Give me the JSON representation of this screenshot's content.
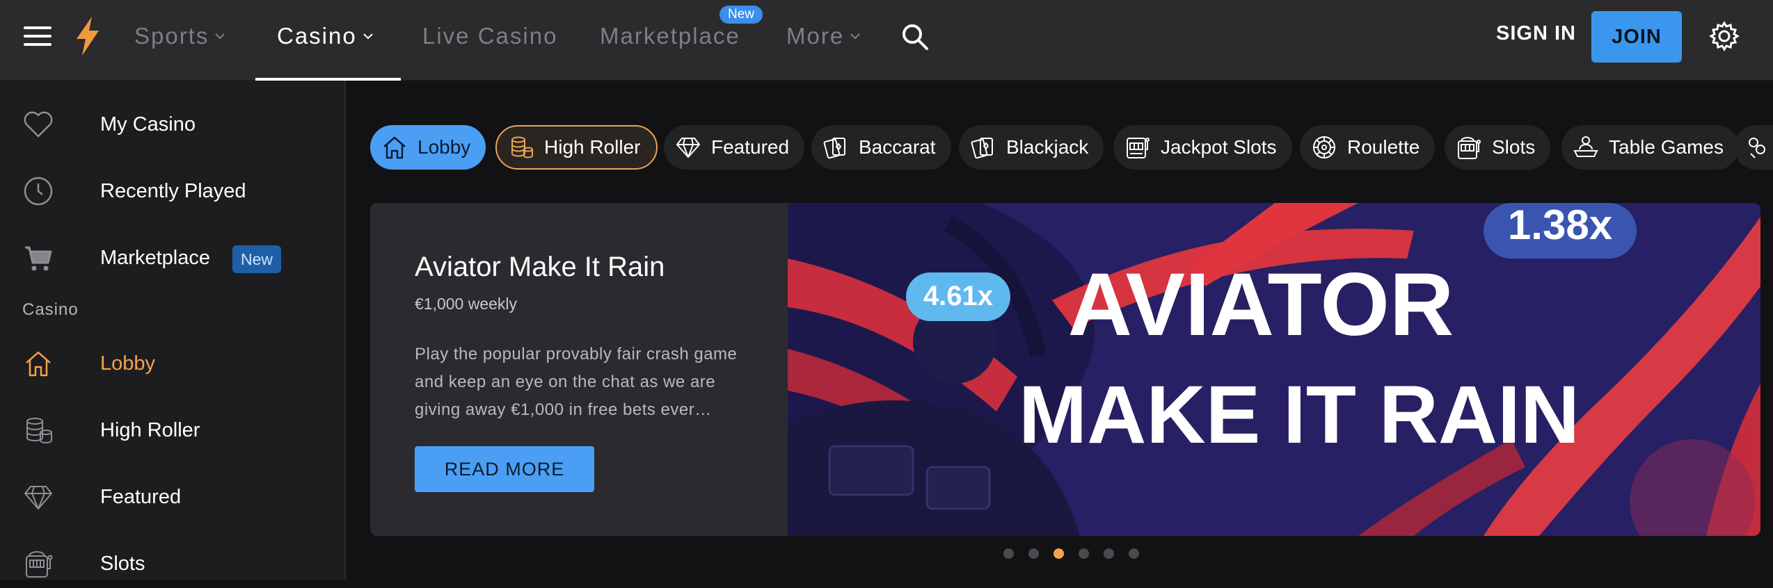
{
  "topbar": {
    "nav": [
      {
        "label": "Sports",
        "has_chevron": true
      },
      {
        "label": "Casino",
        "has_chevron": true,
        "active": true
      },
      {
        "label": "Live Casino"
      },
      {
        "label": "Marketplace",
        "badge": "New"
      },
      {
        "label": "More",
        "has_chevron": true
      }
    ],
    "sign_in": "SIGN IN",
    "join": "JOIN"
  },
  "sidebar": {
    "items": [
      {
        "label": "My Casino",
        "icon": "heart-icon"
      },
      {
        "label": "Recently Played",
        "icon": "clock-icon"
      },
      {
        "label": "Marketplace",
        "icon": "cart-icon",
        "badge": "New"
      }
    ],
    "section": "Casino",
    "casino_items": [
      {
        "label": "Lobby",
        "icon": "home-icon",
        "active": true
      },
      {
        "label": "High Roller",
        "icon": "coins-icon"
      },
      {
        "label": "Featured",
        "icon": "diamond-icon"
      },
      {
        "label": "Slots",
        "icon": "slot-machine-icon"
      }
    ]
  },
  "categories": [
    {
      "label": "Lobby",
      "icon": "home-icon",
      "selected": true
    },
    {
      "label": "High Roller",
      "icon": "coins-icon"
    },
    {
      "label": "Featured",
      "icon": "diamond-icon"
    },
    {
      "label": "Baccarat",
      "icon": "cards-icon"
    },
    {
      "label": "Blackjack",
      "icon": "cards-icon"
    },
    {
      "label": "Jackpot Slots",
      "icon": "jackpot-icon"
    },
    {
      "label": "Roulette",
      "icon": "roulette-icon"
    },
    {
      "label": "Slots",
      "icon": "slot-machine-icon"
    },
    {
      "label": "Table Games",
      "icon": "dealer-icon"
    }
  ],
  "promo": {
    "title": "Aviator Make It Rain",
    "subtitle": "€1,000 weekly",
    "description": "Play the popular provably fair crash game and keep an eye on the chat as we are giving away €1,000 in free bets ever…",
    "button": "READ MORE",
    "banner_line1": "AVIATOR",
    "banner_line2": "MAKE IT RAIN",
    "multiplier_a": "4.61x",
    "multiplier_b": "1.38x"
  },
  "carousel": {
    "count": 6,
    "active_index": 2
  },
  "colors": {
    "accent": "#4a9ff5",
    "active_orange": "#f4a24b",
    "badge_blue": "#3b8fea"
  }
}
